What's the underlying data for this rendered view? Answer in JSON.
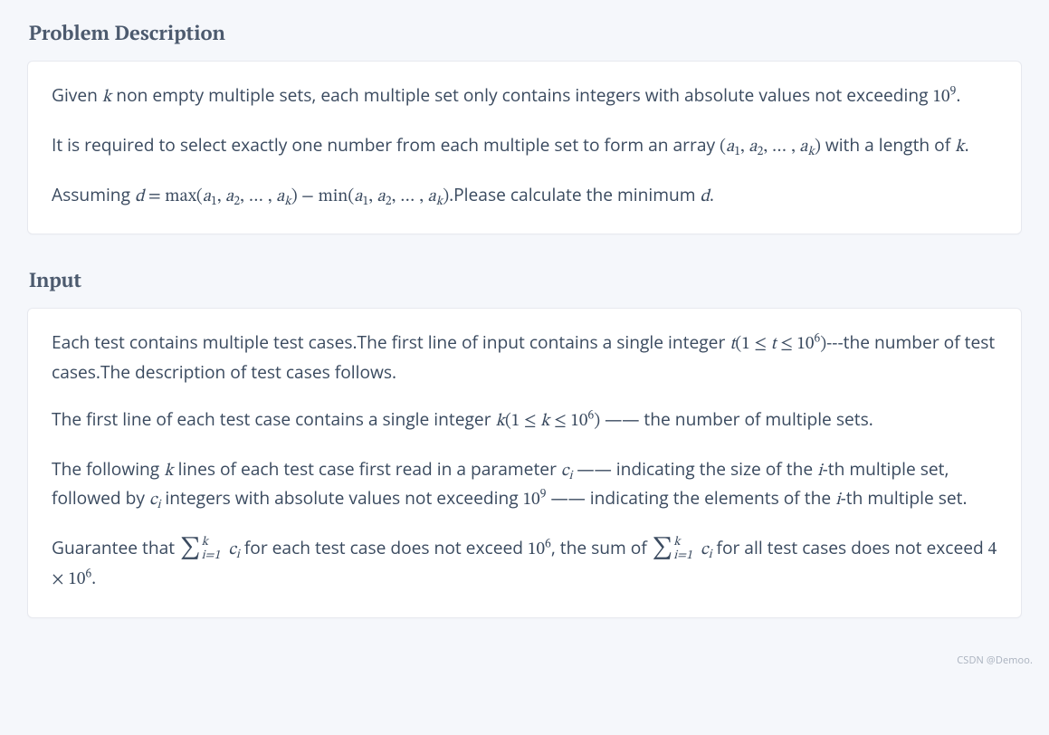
{
  "sections": {
    "problem": {
      "title": "Problem Description",
      "p1_a": "Given ",
      "p1_k": "k",
      "p1_b": " non empty multiple sets, each multiple set only contains integers with absolute values not exceeding ",
      "p1_ten": "10",
      "p1_exp": "9",
      "p1_c": ".",
      "p2_a": "It is required to select exactly one number from each multiple set to form an array ",
      "p2_arr_open": "(",
      "p2_a1": "a",
      "p2_s1": "1",
      "p2_comma1": ", ",
      "p2_a2": "a",
      "p2_s2": "2",
      "p2_comma2": ", … , ",
      "p2_ak": "a",
      "p2_sk": "k",
      "p2_arr_close": ")",
      "p2_b": " with a length of ",
      "p2_k": "k",
      "p2_c": ".",
      "p3_a": "Assuming ",
      "p3_d": "d",
      "p3_eq": " = ",
      "p3_max": "max",
      "p3_open1": "(",
      "p3_m_a1": "a",
      "p3_m_s1": "1",
      "p3_m_c1": ", ",
      "p3_m_a2": "a",
      "p3_m_s2": "2",
      "p3_m_c2": ", … , ",
      "p3_m_ak": "a",
      "p3_m_sk": "k",
      "p3_close1": ")",
      "p3_minus": " − ",
      "p3_min": "min",
      "p3_open2": "(",
      "p3_n_a1": "a",
      "p3_n_s1": "1",
      "p3_n_c1": ", ",
      "p3_n_a2": "a",
      "p3_n_s2": "2",
      "p3_n_c2": ", … , ",
      "p3_n_ak": "a",
      "p3_n_sk": "k",
      "p3_close2": ")",
      "p3_b": ".Please calculate the minimum ",
      "p3_d2": "d",
      "p3_c": "."
    },
    "input": {
      "title": "Input",
      "p1_a": "Each test contains multiple test cases.The first line of input contains a single integer ",
      "p1_t": "t",
      "p1_open": "(",
      "p1_one": "1",
      "p1_le1": " ≤ ",
      "p1_t2": "t",
      "p1_le2": " ≤ ",
      "p1_ten": "10",
      "p1_exp": "6",
      "p1_close": ")",
      "p1_b": "---the number of test cases.The description of test cases follows.",
      "p2_a": "The first line of each test case contains a single integer ",
      "p2_k": "k",
      "p2_open": "(",
      "p2_one": "1",
      "p2_le1": " ≤ ",
      "p2_k2": "k",
      "p2_le2": " ≤ ",
      "p2_ten": "10",
      "p2_exp": "6",
      "p2_close": ")",
      "p2_b": " —— the number of multiple sets.",
      "p3_a": "The following ",
      "p3_k": "k",
      "p3_b": " lines of each test case first read in a parameter ",
      "p3_c": "c",
      "p3_ci": "i",
      "p3_d": " —— indicating the size of the ",
      "p3_i": "i",
      "p3_e": "-th multiple set, followed by ",
      "p3_c2": "c",
      "p3_ci2": "i",
      "p3_f": " integers with absolute values not exceeding ",
      "p3_ten": "10",
      "p3_exp": "9",
      "p3_g": " —— indicating the elements of the ",
      "p3_i2": "i",
      "p3_h": "-th multiple set.",
      "p4_a": "Guarantee that ",
      "p4_sum1_up": "k",
      "p4_sum1_lo": "i=1",
      "p4_c1": "c",
      "p4_ci1": "i",
      "p4_b": " for each test case does not exceed ",
      "p4_ten1": "10",
      "p4_exp1": "6",
      "p4_c": ", the sum of ",
      "p4_sum2_up": "k",
      "p4_sum2_lo": "i=1",
      "p4_c2": "c",
      "p4_ci2": "i",
      "p4_d": " for all test cases does not exceed ",
      "p4_four": "4",
      "p4_times": " × ",
      "p4_ten2": "10",
      "p4_exp2": "6",
      "p4_e": "."
    }
  },
  "watermark": "CSDN @Demoo."
}
